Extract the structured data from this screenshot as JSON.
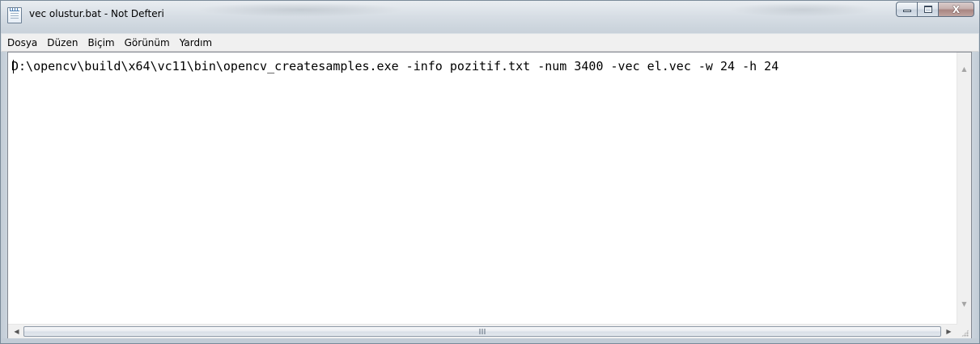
{
  "window": {
    "title": "vec olustur.bat - Not Defteri",
    "app_icon": "notepad-icon",
    "controls": {
      "minimize_icon": "minimize-icon",
      "maximize_icon": "maximize-icon",
      "close_icon": "close-icon",
      "close_glyph": "X"
    }
  },
  "menubar": {
    "items": [
      {
        "label": "Dosya"
      },
      {
        "label": "Düzen"
      },
      {
        "label": "Biçim"
      },
      {
        "label": "Görünüm"
      },
      {
        "label": "Yardım"
      }
    ]
  },
  "editor": {
    "content": "D:\\opencv\\build\\x64\\vc11\\bin\\opencv_createsamples.exe -info pozitif.txt -num 3400 -vec el.vec -w 24 -h 24"
  },
  "scrollbars": {
    "vertical": {
      "up_icon": "scroll-up-arrow-icon",
      "down_icon": "scroll-down-arrow-icon",
      "up_glyph": "▲",
      "down_glyph": "▼"
    },
    "horizontal": {
      "left_icon": "scroll-left-arrow-icon",
      "right_icon": "scroll-right-arrow-icon",
      "left_glyph": "◀",
      "right_glyph": "▶"
    }
  },
  "colors": {
    "titlebar": "#d6dde4",
    "menubar": "#f0f0f0",
    "editor_background": "#ffffff",
    "close_button": "#c7b1af"
  }
}
